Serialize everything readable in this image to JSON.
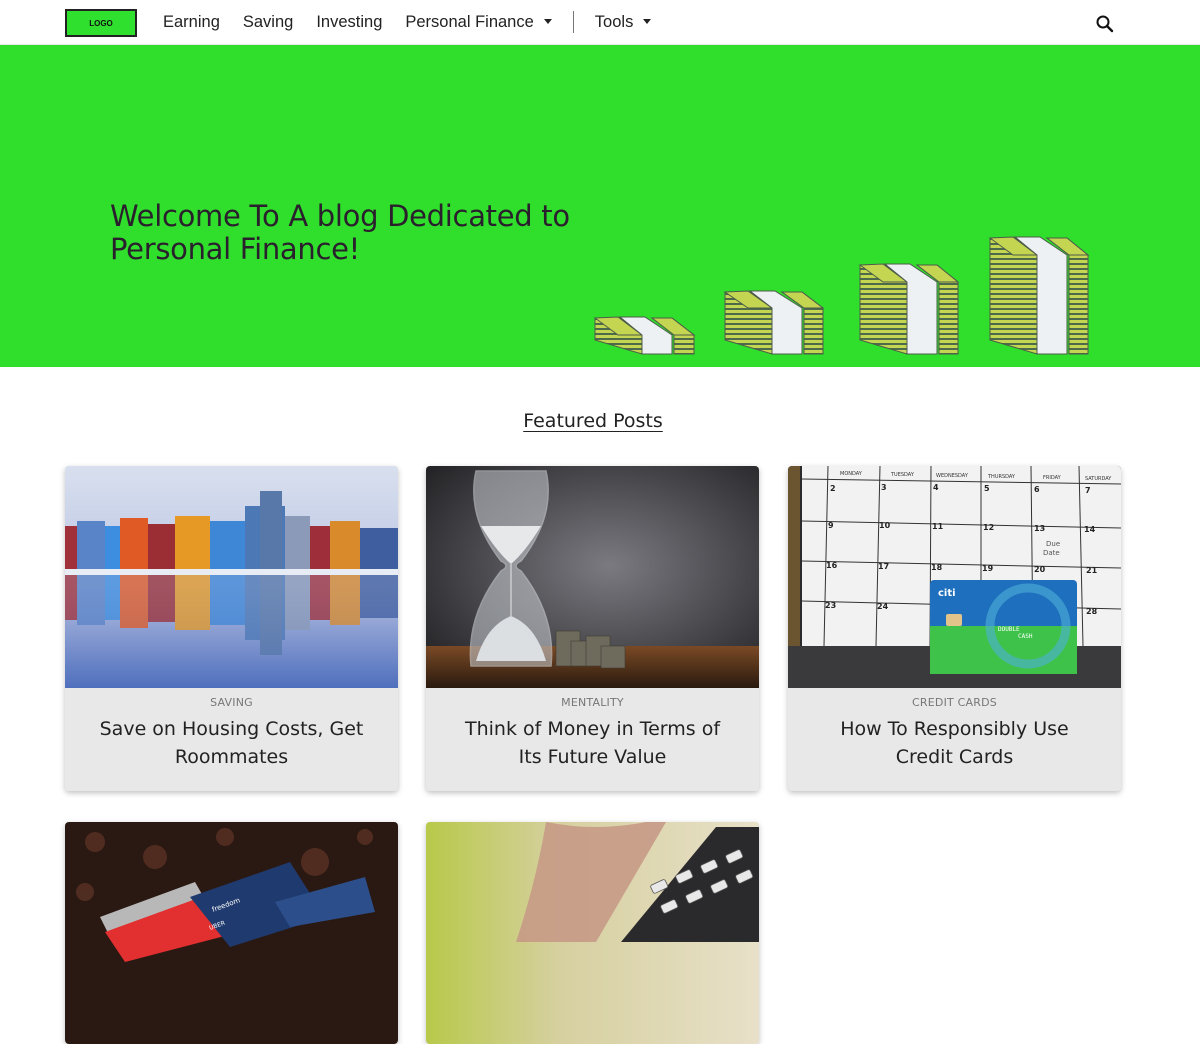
{
  "nav": {
    "logo": "LOGO",
    "links": [
      {
        "label": "Earning"
      },
      {
        "label": "Saving"
      },
      {
        "label": "Investing"
      },
      {
        "label": "Personal Finance",
        "dropdown": true
      },
      {
        "label": "Tools",
        "dropdown": true
      }
    ],
    "search_icon": "search-icon"
  },
  "hero": {
    "title": "Welcome To A blog Dedicated to Personal Finance!",
    "background_color": "#30df2b",
    "illustration": "money-stacks-growing"
  },
  "featured": {
    "heading": "Featured Posts",
    "posts": [
      {
        "category": "SAVING",
        "title": "Save on Housing Costs, Get Roommates",
        "image": "colorful-houses-reflection"
      },
      {
        "category": "MENTALITY",
        "title": "Think of Money in Terms of Its Future Value",
        "image": "hourglass-coins"
      },
      {
        "category": "CREDIT CARDS",
        "title": "How To Responsibly Use Credit Cards",
        "image": "calendar-credit-card"
      },
      {
        "image": "credit-cards-on-granite"
      },
      {
        "image": "calculator-hand"
      }
    ]
  }
}
